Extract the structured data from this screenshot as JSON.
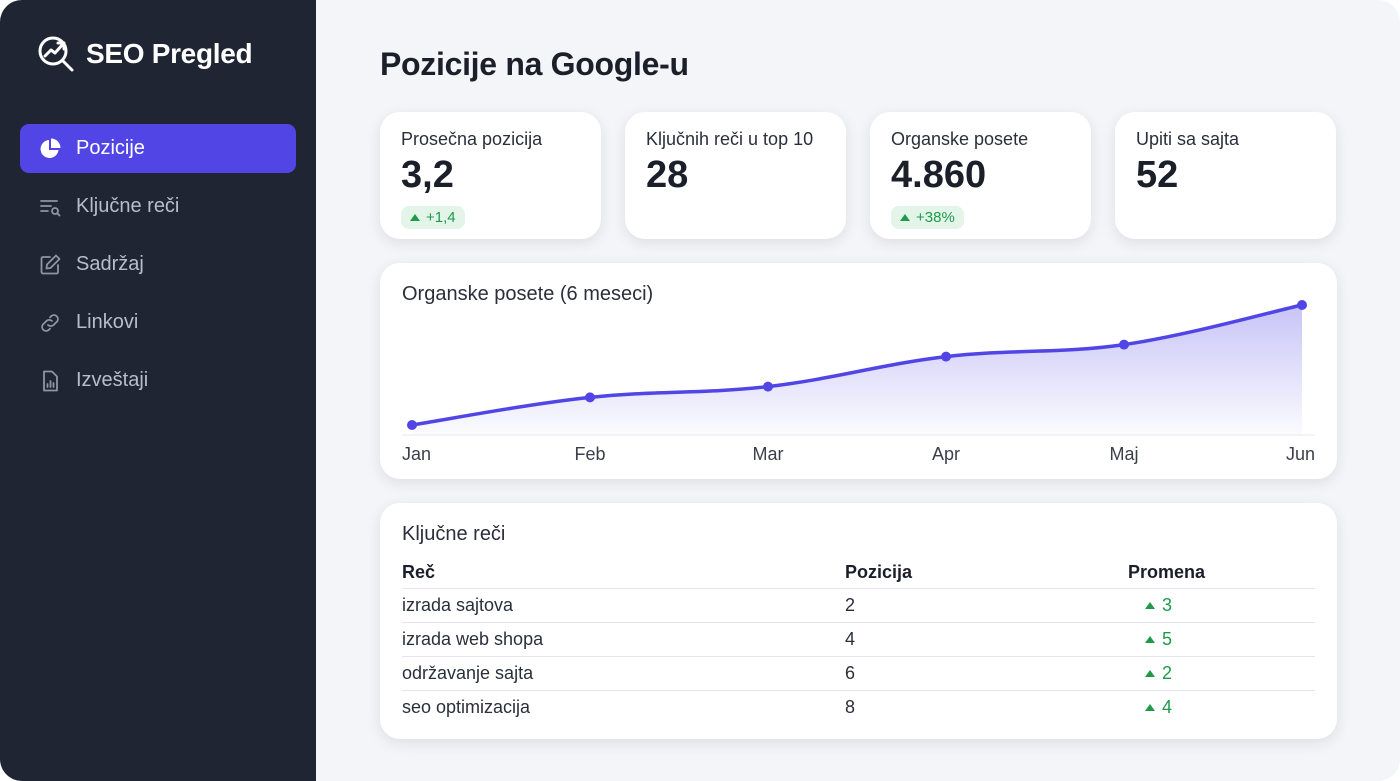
{
  "brand": {
    "name": "SEO Pregled",
    "icon": "search-growth-icon"
  },
  "sidebar": {
    "items": [
      {
        "label": "Pozicije",
        "icon": "pie-chart-icon",
        "active": true
      },
      {
        "label": "Ključne reči",
        "icon": "list-search-icon",
        "active": false
      },
      {
        "label": "Sadržaj",
        "icon": "edit-icon",
        "active": false
      },
      {
        "label": "Linkovi",
        "icon": "link-icon",
        "active": false
      },
      {
        "label": "Izveštaji",
        "icon": "report-icon",
        "active": false
      }
    ]
  },
  "page": {
    "title": "Pozicije na Google-u"
  },
  "stats": [
    {
      "label": "Prosečna pozicija",
      "value": "3,2",
      "change": "+1,4"
    },
    {
      "label": "Ključnih reči u top 10",
      "value": "28",
      "change": ""
    },
    {
      "label": "Organske posete",
      "value": "4.860",
      "change": "+38%"
    },
    {
      "label": "Upiti sa sajta",
      "value": "52",
      "change": ""
    }
  ],
  "chart": {
    "title": "Organske posete (6 meseci)"
  },
  "chart_data": {
    "type": "area",
    "title": "Organske posete (6 meseci)",
    "categories": [
      "Jan",
      "Feb",
      "Mar",
      "Apr",
      "Maj",
      "Jun"
    ],
    "values": [
      0,
      23,
      32,
      57,
      67,
      100
    ],
    "ylim": [
      0,
      100
    ],
    "grid": false,
    "color": "#5146e5"
  },
  "keywords": {
    "title": "Ključne reči",
    "headers": [
      "Reč",
      "Pozicija",
      "Promena"
    ],
    "rows": [
      {
        "word": "izrada sajtova",
        "position": "2",
        "change": "3"
      },
      {
        "word": "izrada web shopa",
        "position": "4",
        "change": "5"
      },
      {
        "word": "održavanje sajta",
        "position": "6",
        "change": "2"
      },
      {
        "word": "seo optimizacija",
        "position": "8",
        "change": "4"
      }
    ]
  },
  "colors": {
    "accent": "#5146e5",
    "sidebar_bg": "#1f2532",
    "positive": "#1f9a4b"
  }
}
